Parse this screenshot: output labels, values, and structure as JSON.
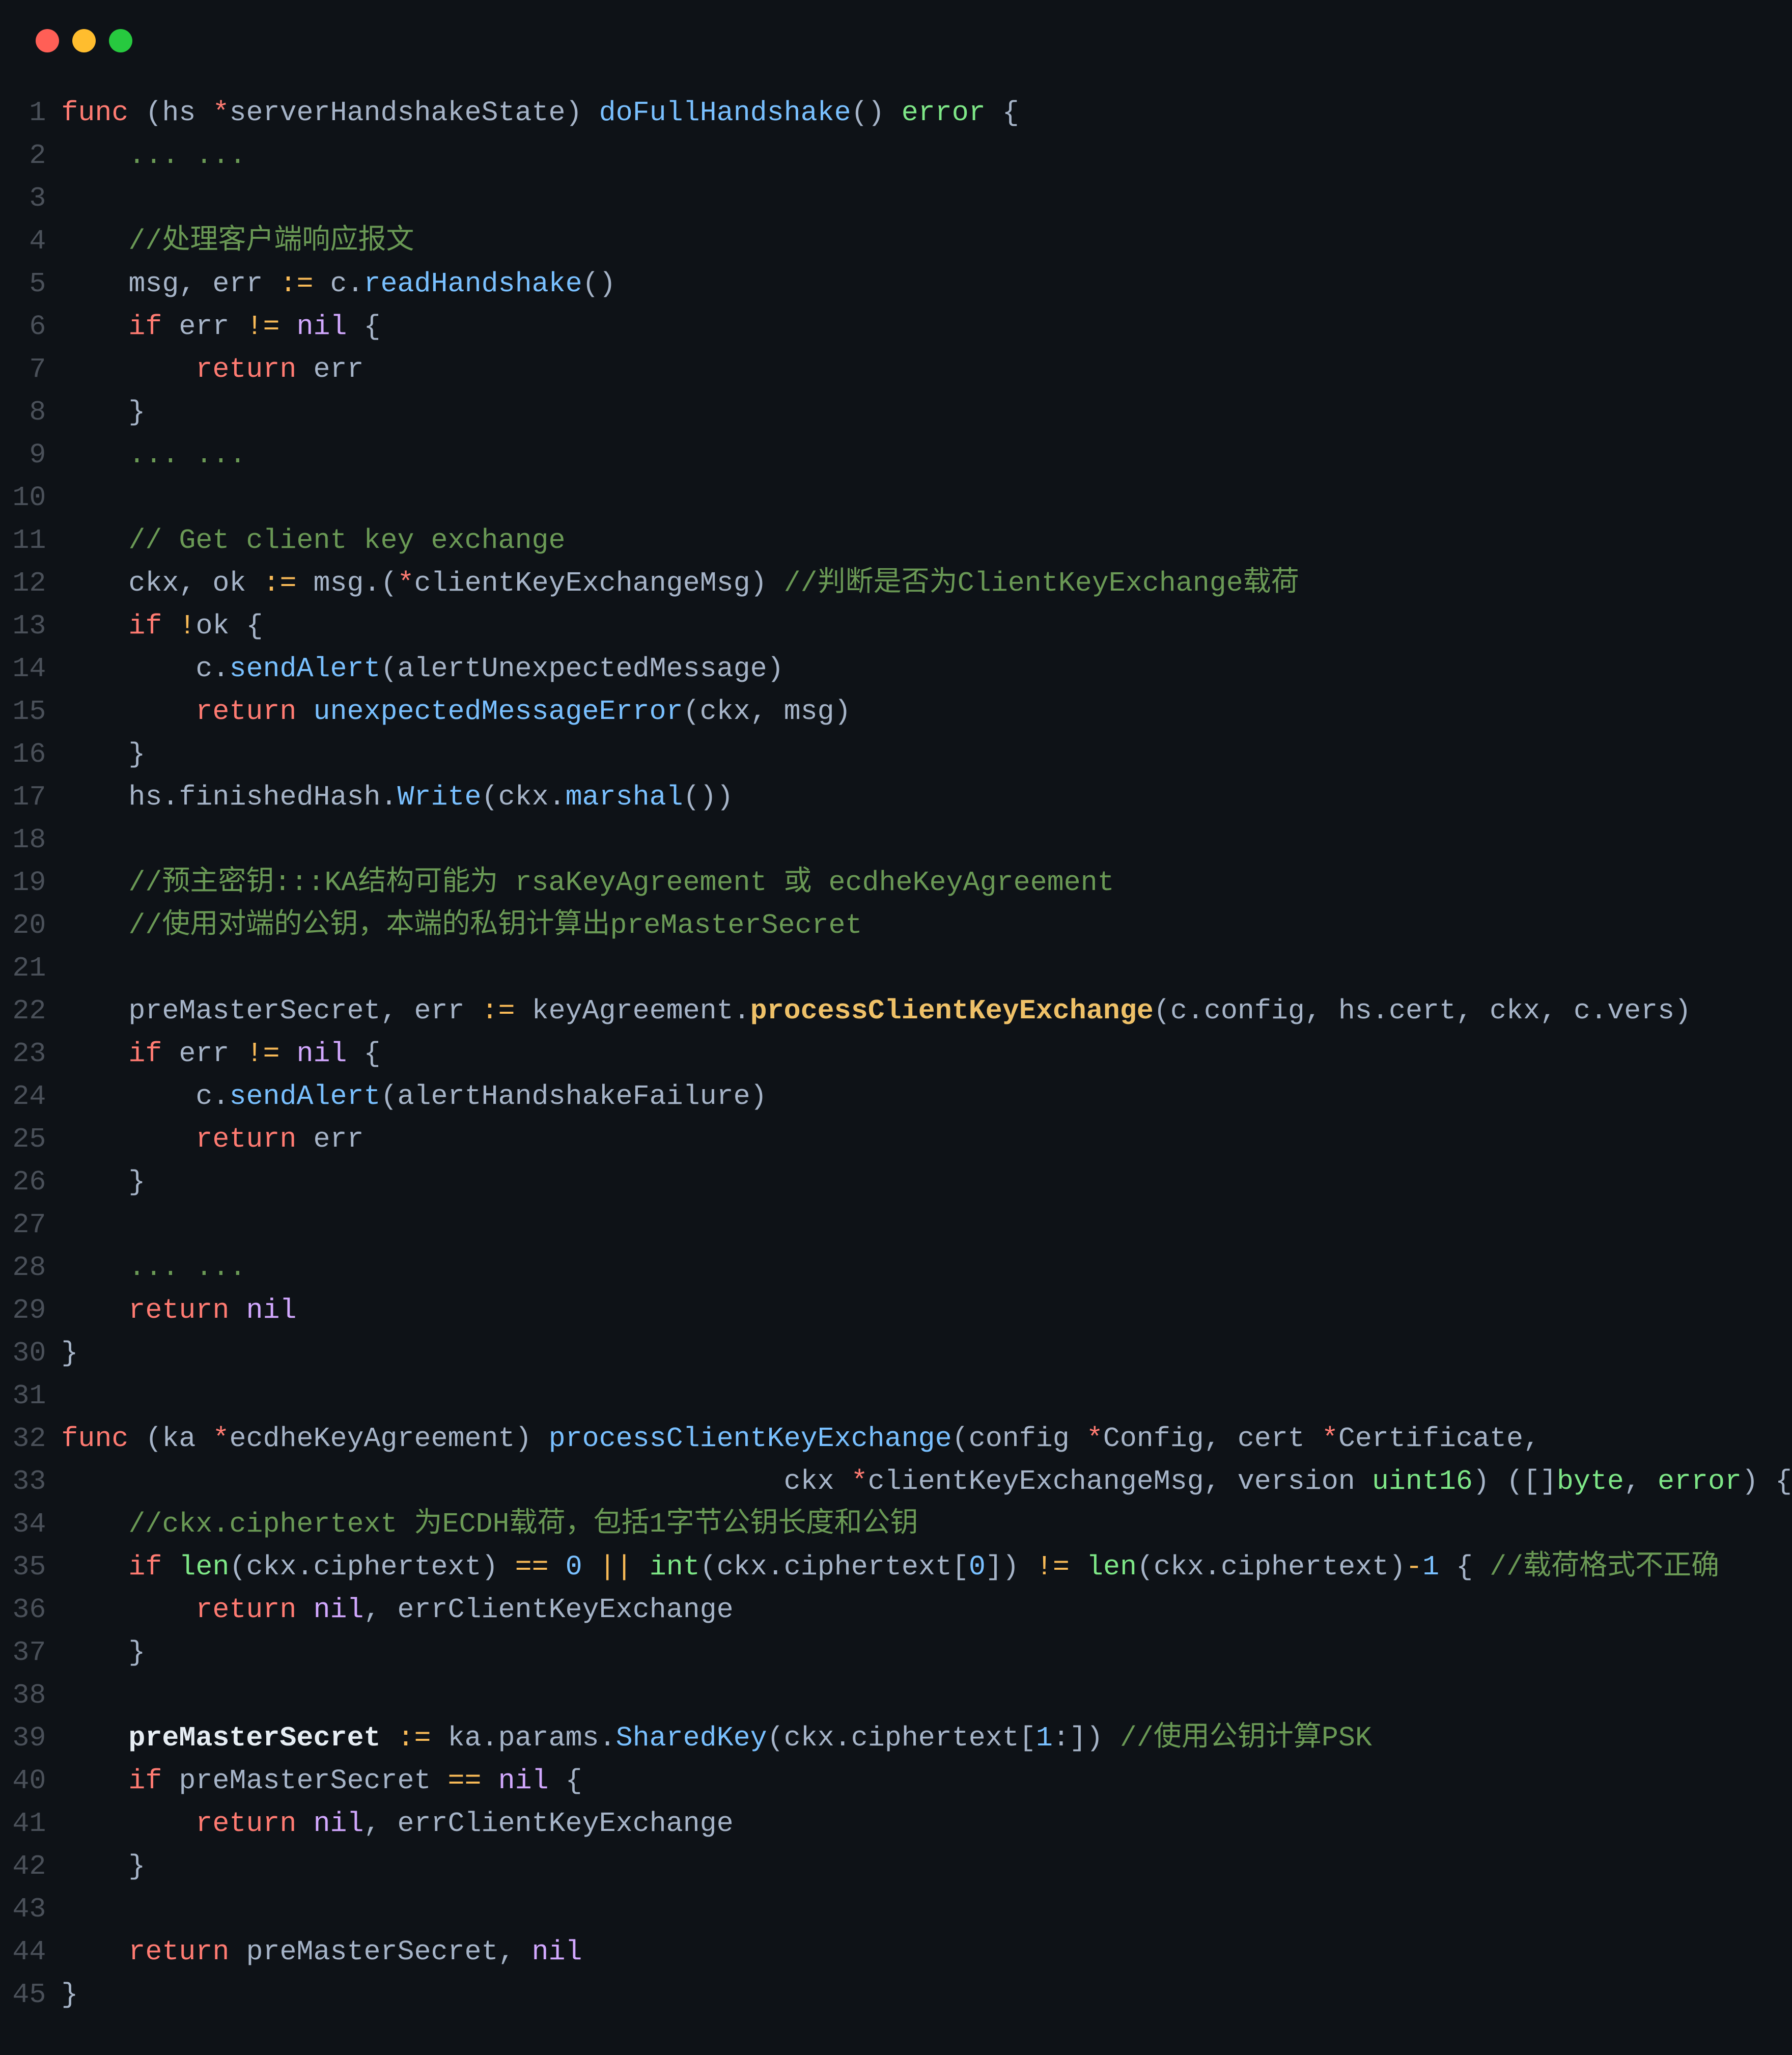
{
  "window": {
    "buttons": [
      "close",
      "minimize",
      "maximize"
    ]
  },
  "code": {
    "lines": [
      {
        "n": 1,
        "tokens": [
          [
            "kw",
            "func"
          ],
          [
            "punc",
            " ("
          ],
          [
            "id",
            "hs "
          ],
          [
            "star",
            "*"
          ],
          [
            "id",
            "serverHandshakeState"
          ],
          [
            "punc",
            ") "
          ],
          [
            "fn",
            "doFullHandshake"
          ],
          [
            "punc",
            "() "
          ],
          [
            "type",
            "error"
          ],
          [
            "punc",
            " {"
          ]
        ]
      },
      {
        "n": 2,
        "tokens": [
          [
            "dots",
            "    ... ..."
          ]
        ]
      },
      {
        "n": 3,
        "tokens": []
      },
      {
        "n": 4,
        "tokens": [
          [
            "cm",
            "    //处理客户端响应报文"
          ]
        ]
      },
      {
        "n": 5,
        "tokens": [
          [
            "id",
            "    msg"
          ],
          [
            "punc",
            ", "
          ],
          [
            "id",
            "err"
          ],
          [
            "punc",
            " "
          ],
          [
            "op",
            ":="
          ],
          [
            "punc",
            " "
          ],
          [
            "id",
            "c"
          ],
          [
            "punc",
            "."
          ],
          [
            "fn",
            "readHandshake"
          ],
          [
            "punc",
            "()"
          ]
        ]
      },
      {
        "n": 6,
        "tokens": [
          [
            "kw",
            "    if"
          ],
          [
            "punc",
            " "
          ],
          [
            "id",
            "err"
          ],
          [
            "punc",
            " "
          ],
          [
            "op",
            "!="
          ],
          [
            "punc",
            " "
          ],
          [
            "nil",
            "nil"
          ],
          [
            "punc",
            " {"
          ]
        ]
      },
      {
        "n": 7,
        "tokens": [
          [
            "kw",
            "        return"
          ],
          [
            "punc",
            " "
          ],
          [
            "id",
            "err"
          ]
        ]
      },
      {
        "n": 8,
        "tokens": [
          [
            "punc",
            "    }"
          ]
        ]
      },
      {
        "n": 9,
        "tokens": [
          [
            "dots",
            "    ... ..."
          ]
        ]
      },
      {
        "n": 10,
        "tokens": []
      },
      {
        "n": 11,
        "tokens": [
          [
            "cm",
            "    // Get client key exchange"
          ]
        ]
      },
      {
        "n": 12,
        "tokens": [
          [
            "id",
            "    ckx"
          ],
          [
            "punc",
            ", "
          ],
          [
            "id",
            "ok"
          ],
          [
            "punc",
            " "
          ],
          [
            "op",
            ":="
          ],
          [
            "punc",
            " "
          ],
          [
            "id",
            "msg"
          ],
          [
            "punc",
            ".("
          ],
          [
            "star",
            "*"
          ],
          [
            "id",
            "clientKeyExchangeMsg"
          ],
          [
            "punc",
            ") "
          ],
          [
            "cm",
            "//判断是否为ClientKeyExchange载荷"
          ]
        ]
      },
      {
        "n": 13,
        "tokens": [
          [
            "kw",
            "    if"
          ],
          [
            "punc",
            " "
          ],
          [
            "op",
            "!"
          ],
          [
            "id",
            "ok"
          ],
          [
            "punc",
            " {"
          ]
        ]
      },
      {
        "n": 14,
        "tokens": [
          [
            "id",
            "        c"
          ],
          [
            "punc",
            "."
          ],
          [
            "fn",
            "sendAlert"
          ],
          [
            "punc",
            "("
          ],
          [
            "id",
            "alertUnexpectedMessage"
          ],
          [
            "punc",
            ")"
          ]
        ]
      },
      {
        "n": 15,
        "tokens": [
          [
            "kw",
            "        return"
          ],
          [
            "punc",
            " "
          ],
          [
            "fn",
            "unexpectedMessageError"
          ],
          [
            "punc",
            "("
          ],
          [
            "id",
            "ckx"
          ],
          [
            "punc",
            ", "
          ],
          [
            "id",
            "msg"
          ],
          [
            "punc",
            ")"
          ]
        ]
      },
      {
        "n": 16,
        "tokens": [
          [
            "punc",
            "    }"
          ]
        ]
      },
      {
        "n": 17,
        "tokens": [
          [
            "id",
            "    hs"
          ],
          [
            "punc",
            "."
          ],
          [
            "id",
            "finishedHash"
          ],
          [
            "punc",
            "."
          ],
          [
            "fn",
            "Write"
          ],
          [
            "punc",
            "("
          ],
          [
            "id",
            "ckx"
          ],
          [
            "punc",
            "."
          ],
          [
            "fn",
            "marshal"
          ],
          [
            "punc",
            "())"
          ]
        ]
      },
      {
        "n": 18,
        "tokens": []
      },
      {
        "n": 19,
        "tokens": [
          [
            "cm",
            "    //预主密钥:::KA结构可能为 rsaKeyAgreement 或 ecdheKeyAgreement"
          ]
        ]
      },
      {
        "n": 20,
        "tokens": [
          [
            "cm",
            "    //使用对端的公钥，本端的私钥计算出preMasterSecret"
          ]
        ]
      },
      {
        "n": 21,
        "tokens": []
      },
      {
        "n": 22,
        "tokens": [
          [
            "id",
            "    preMasterSecret"
          ],
          [
            "punc",
            ", "
          ],
          [
            "id",
            "err"
          ],
          [
            "punc",
            " "
          ],
          [
            "op",
            ":="
          ],
          [
            "punc",
            " "
          ],
          [
            "id",
            "keyAgreement"
          ],
          [
            "punc",
            "."
          ],
          [
            "fnY bold",
            "processClientKeyExchange"
          ],
          [
            "punc",
            "("
          ],
          [
            "id",
            "c"
          ],
          [
            "punc",
            "."
          ],
          [
            "id",
            "config"
          ],
          [
            "punc",
            ", "
          ],
          [
            "id",
            "hs"
          ],
          [
            "punc",
            "."
          ],
          [
            "id",
            "cert"
          ],
          [
            "punc",
            ", "
          ],
          [
            "id",
            "ckx"
          ],
          [
            "punc",
            ", "
          ],
          [
            "id",
            "c"
          ],
          [
            "punc",
            "."
          ],
          [
            "id",
            "vers"
          ],
          [
            "punc",
            ")"
          ]
        ]
      },
      {
        "n": 23,
        "tokens": [
          [
            "kw",
            "    if"
          ],
          [
            "punc",
            " "
          ],
          [
            "id",
            "err"
          ],
          [
            "punc",
            " "
          ],
          [
            "op",
            "!="
          ],
          [
            "punc",
            " "
          ],
          [
            "nil",
            "nil"
          ],
          [
            "punc",
            " {"
          ]
        ]
      },
      {
        "n": 24,
        "tokens": [
          [
            "id",
            "        c"
          ],
          [
            "punc",
            "."
          ],
          [
            "fn",
            "sendAlert"
          ],
          [
            "punc",
            "("
          ],
          [
            "id",
            "alertHandshakeFailure"
          ],
          [
            "punc",
            ")"
          ]
        ]
      },
      {
        "n": 25,
        "tokens": [
          [
            "kw",
            "        return"
          ],
          [
            "punc",
            " "
          ],
          [
            "id",
            "err"
          ]
        ]
      },
      {
        "n": 26,
        "tokens": [
          [
            "punc",
            "    }"
          ]
        ]
      },
      {
        "n": 27,
        "tokens": []
      },
      {
        "n": 28,
        "tokens": [
          [
            "dots",
            "    ... ..."
          ]
        ]
      },
      {
        "n": 29,
        "tokens": [
          [
            "kw",
            "    return"
          ],
          [
            "punc",
            " "
          ],
          [
            "nil",
            "nil"
          ]
        ]
      },
      {
        "n": 30,
        "tokens": [
          [
            "punc",
            "}"
          ]
        ]
      },
      {
        "n": 31,
        "tokens": []
      },
      {
        "n": 32,
        "tokens": [
          [
            "kw",
            "func"
          ],
          [
            "punc",
            " ("
          ],
          [
            "id",
            "ka "
          ],
          [
            "star",
            "*"
          ],
          [
            "id",
            "ecdheKeyAgreement"
          ],
          [
            "punc",
            ") "
          ],
          [
            "fn",
            "processClientKeyExchange"
          ],
          [
            "punc",
            "("
          ],
          [
            "id",
            "config "
          ],
          [
            "star",
            "*"
          ],
          [
            "id",
            "Config"
          ],
          [
            "punc",
            ", "
          ],
          [
            "id",
            "cert "
          ],
          [
            "star",
            "*"
          ],
          [
            "id",
            "Certificate"
          ],
          [
            "punc",
            ","
          ]
        ]
      },
      {
        "n": 33,
        "tokens": [
          [
            "punc",
            "                                           "
          ],
          [
            "id",
            "ckx "
          ],
          [
            "star",
            "*"
          ],
          [
            "id",
            "clientKeyExchangeMsg"
          ],
          [
            "punc",
            ", "
          ],
          [
            "id",
            "version "
          ],
          [
            "type",
            "uint16"
          ],
          [
            "punc",
            ") ([]"
          ],
          [
            "type",
            "byte"
          ],
          [
            "punc",
            ", "
          ],
          [
            "type",
            "error"
          ],
          [
            "punc",
            ") {"
          ]
        ]
      },
      {
        "n": 34,
        "tokens": [
          [
            "cm",
            "    //ckx.ciphertext 为ECDH载荷，包括1字节公钥长度和公钥"
          ]
        ]
      },
      {
        "n": 35,
        "tokens": [
          [
            "kw",
            "    if"
          ],
          [
            "punc",
            " "
          ],
          [
            "fnG",
            "len"
          ],
          [
            "punc",
            "("
          ],
          [
            "id",
            "ckx"
          ],
          [
            "punc",
            "."
          ],
          [
            "id",
            "ciphertext"
          ],
          [
            "punc",
            ") "
          ],
          [
            "op",
            "=="
          ],
          [
            "punc",
            " "
          ],
          [
            "num",
            "0"
          ],
          [
            "punc",
            " "
          ],
          [
            "op",
            "||"
          ],
          [
            "punc",
            " "
          ],
          [
            "fnG",
            "int"
          ],
          [
            "punc",
            "("
          ],
          [
            "id",
            "ckx"
          ],
          [
            "punc",
            "."
          ],
          [
            "id",
            "ciphertext"
          ],
          [
            "punc",
            "["
          ],
          [
            "num",
            "0"
          ],
          [
            "punc",
            "]) "
          ],
          [
            "op",
            "!="
          ],
          [
            "punc",
            " "
          ],
          [
            "fnG",
            "len"
          ],
          [
            "punc",
            "("
          ],
          [
            "id",
            "ckx"
          ],
          [
            "punc",
            "."
          ],
          [
            "id",
            "ciphertext"
          ],
          [
            "punc",
            ")"
          ],
          [
            "op",
            "-"
          ],
          [
            "num",
            "1"
          ],
          [
            "punc",
            " { "
          ],
          [
            "cm",
            "//载荷格式不正确"
          ]
        ]
      },
      {
        "n": 36,
        "tokens": [
          [
            "kw",
            "        return"
          ],
          [
            "punc",
            " "
          ],
          [
            "nil",
            "nil"
          ],
          [
            "punc",
            ", "
          ],
          [
            "id",
            "errClientKeyExchange"
          ]
        ]
      },
      {
        "n": 37,
        "tokens": [
          [
            "punc",
            "    }"
          ]
        ]
      },
      {
        "n": 38,
        "tokens": []
      },
      {
        "n": 39,
        "tokens": [
          [
            "white bold",
            "    preMasterSecret"
          ],
          [
            "punc",
            " "
          ],
          [
            "op",
            ":="
          ],
          [
            "punc",
            " "
          ],
          [
            "id",
            "ka"
          ],
          [
            "punc",
            "."
          ],
          [
            "id",
            "params"
          ],
          [
            "punc",
            "."
          ],
          [
            "fn",
            "SharedKey"
          ],
          [
            "punc",
            "("
          ],
          [
            "id",
            "ckx"
          ],
          [
            "punc",
            "."
          ],
          [
            "id",
            "ciphertext"
          ],
          [
            "punc",
            "["
          ],
          [
            "num",
            "1"
          ],
          [
            "punc",
            ":]) "
          ],
          [
            "cm",
            "//使用公钥计算PSK"
          ]
        ]
      },
      {
        "n": 40,
        "tokens": [
          [
            "kw",
            "    if"
          ],
          [
            "punc",
            " "
          ],
          [
            "id",
            "preMasterSecret"
          ],
          [
            "punc",
            " "
          ],
          [
            "op",
            "=="
          ],
          [
            "punc",
            " "
          ],
          [
            "nil",
            "nil"
          ],
          [
            "punc",
            " {"
          ]
        ]
      },
      {
        "n": 41,
        "tokens": [
          [
            "kw",
            "        return"
          ],
          [
            "punc",
            " "
          ],
          [
            "nil",
            "nil"
          ],
          [
            "punc",
            ", "
          ],
          [
            "id",
            "errClientKeyExchange"
          ]
        ]
      },
      {
        "n": 42,
        "tokens": [
          [
            "punc",
            "    }"
          ]
        ]
      },
      {
        "n": 43,
        "tokens": []
      },
      {
        "n": 44,
        "tokens": [
          [
            "kw",
            "    return"
          ],
          [
            "punc",
            " "
          ],
          [
            "id",
            "preMasterSecret"
          ],
          [
            "punc",
            ", "
          ],
          [
            "nil",
            "nil"
          ]
        ]
      },
      {
        "n": 45,
        "tokens": [
          [
            "punc",
            "}"
          ]
        ]
      }
    ]
  }
}
